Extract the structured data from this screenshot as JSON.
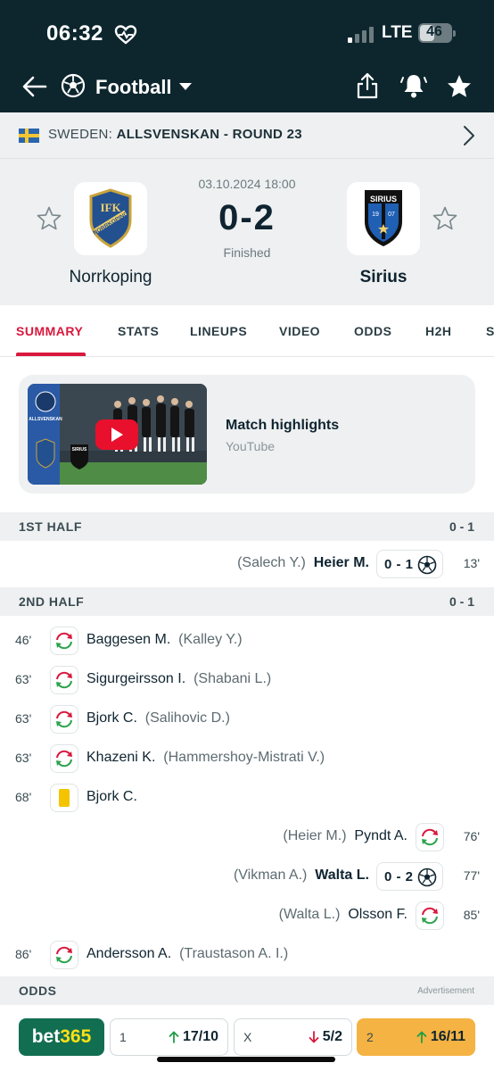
{
  "status": {
    "time": "06:32",
    "network": "LTE",
    "battery": "46",
    "battery_level": 0.46
  },
  "nav": {
    "title": "Football"
  },
  "league": {
    "country": "SWEDEN:",
    "name": "ALLSVENSKAN - ROUND 23"
  },
  "match": {
    "date": "03.10.2024 18:00",
    "score": "0-2",
    "status": "Finished",
    "home": {
      "name": "Norrkoping"
    },
    "away": {
      "name": "Sirius"
    }
  },
  "tabs": [
    "SUMMARY",
    "STATS",
    "LINEUPS",
    "VIDEO",
    "ODDS",
    "H2H",
    "S"
  ],
  "video": {
    "title": "Match highlights",
    "source": "YouTube",
    "thumb_text": "ALLSVENSKAN",
    "thumb_team": "SIRIUS"
  },
  "first_half": {
    "label": "1ST HALF",
    "score": "0 - 1",
    "events": [
      {
        "side": "away",
        "type": "goal",
        "minute": "13'",
        "player": "Heier M.",
        "assist": "(Salech Y.)",
        "score": "0 - 1"
      }
    ]
  },
  "second_half": {
    "label": "2ND HALF",
    "score": "0 - 1",
    "events": [
      {
        "side": "home",
        "type": "sub",
        "minute": "46'",
        "player": "Baggesen M.",
        "assist": "(Kalley Y.)"
      },
      {
        "side": "home",
        "type": "sub",
        "minute": "63'",
        "player": "Sigurgeirsson I.",
        "assist": "(Shabani L.)"
      },
      {
        "side": "home",
        "type": "sub",
        "minute": "63'",
        "player": "Bjork C.",
        "assist": "(Salihovic D.)"
      },
      {
        "side": "home",
        "type": "sub",
        "minute": "63'",
        "player": "Khazeni K.",
        "assist": "(Hammershoy-Mistrati V.)"
      },
      {
        "side": "home",
        "type": "yellow",
        "minute": "68'",
        "player": "Bjork C.",
        "assist": ""
      },
      {
        "side": "away",
        "type": "sub",
        "minute": "76'",
        "player": "Pyndt A.",
        "assist": "(Heier M.)"
      },
      {
        "side": "away",
        "type": "goal",
        "minute": "77'",
        "player": "Walta L.",
        "assist": "(Vikman A.)",
        "score": "0 - 2"
      },
      {
        "side": "away",
        "type": "sub",
        "minute": "85'",
        "player": "Olsson F.",
        "assist": "(Walta L.)"
      },
      {
        "side": "home",
        "type": "sub",
        "minute": "86'",
        "player": "Andersson A.",
        "assist": "(Traustason A. I.)"
      }
    ]
  },
  "odds": {
    "label": "ODDS",
    "ad": "Advertisement",
    "bookmaker_a": "bet",
    "bookmaker_b": "365",
    "items": [
      {
        "key": "1",
        "value": "17/10",
        "trend": "up"
      },
      {
        "key": "X",
        "value": "5/2",
        "trend": "down"
      },
      {
        "key": "2",
        "value": "16/11",
        "trend": "up"
      }
    ]
  },
  "colors": {
    "header": "#0d262e",
    "accent": "#d9183d",
    "green": "#126e51",
    "yellow_card": "#f5c400",
    "highlight_odds": "#f5b343"
  }
}
